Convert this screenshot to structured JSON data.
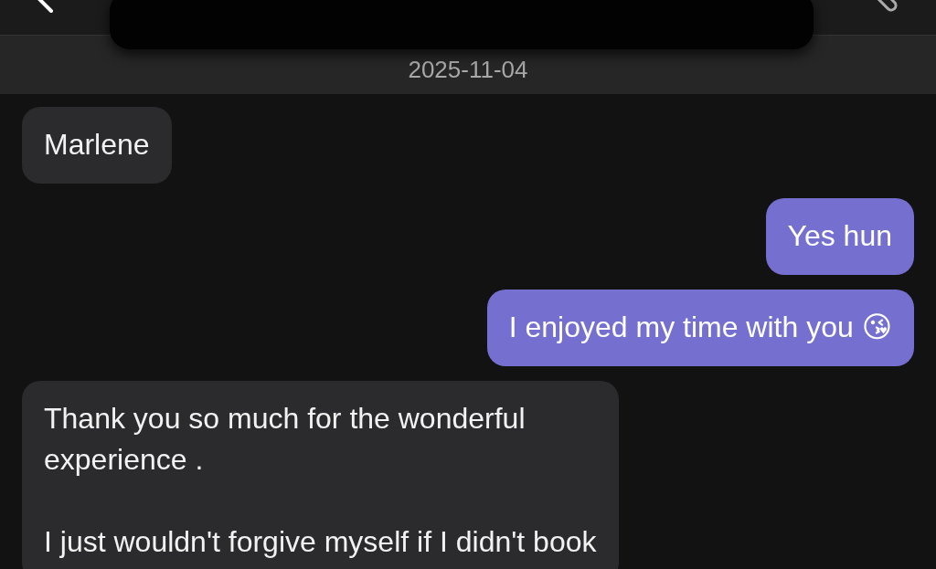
{
  "date_divider": "2025-11-04",
  "messages": [
    {
      "kind": "incoming",
      "text": "Marlene"
    },
    {
      "kind": "outgoing",
      "text": "Yes hun"
    },
    {
      "kind": "outgoing",
      "text": "I enjoyed my time with you 😘"
    },
    {
      "kind": "incoming",
      "text": "Thank you so much for the wonderful\nexperience .\n\nI just wouldn't forgive myself if I didn't book"
    }
  ]
}
